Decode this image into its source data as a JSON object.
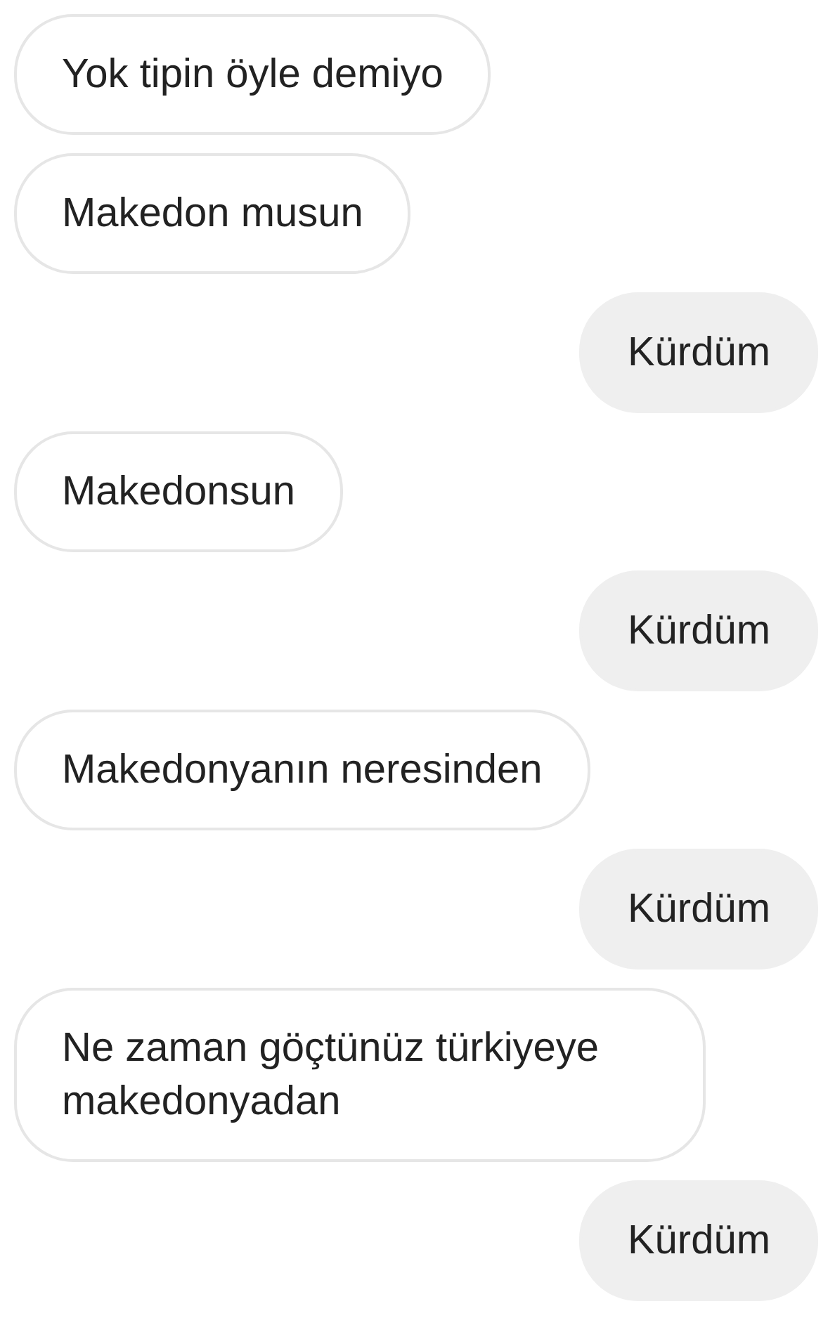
{
  "messages": [
    {
      "kind": "incoming",
      "text": "Yok tipin öyle demiyo"
    },
    {
      "kind": "incoming",
      "text": "Makedon musun"
    },
    {
      "kind": "outgoing",
      "text": "Kürdüm"
    },
    {
      "kind": "incoming",
      "text": "Makedonsun"
    },
    {
      "kind": "outgoing",
      "text": "Kürdüm"
    },
    {
      "kind": "incoming",
      "text": "Makedonyanın neresinden"
    },
    {
      "kind": "outgoing",
      "text": "Kürdüm"
    },
    {
      "kind": "incoming",
      "text": "Ne zaman göçtünüz türkiyeye makedonyadan"
    },
    {
      "kind": "outgoing",
      "text": "Kürdüm"
    }
  ]
}
